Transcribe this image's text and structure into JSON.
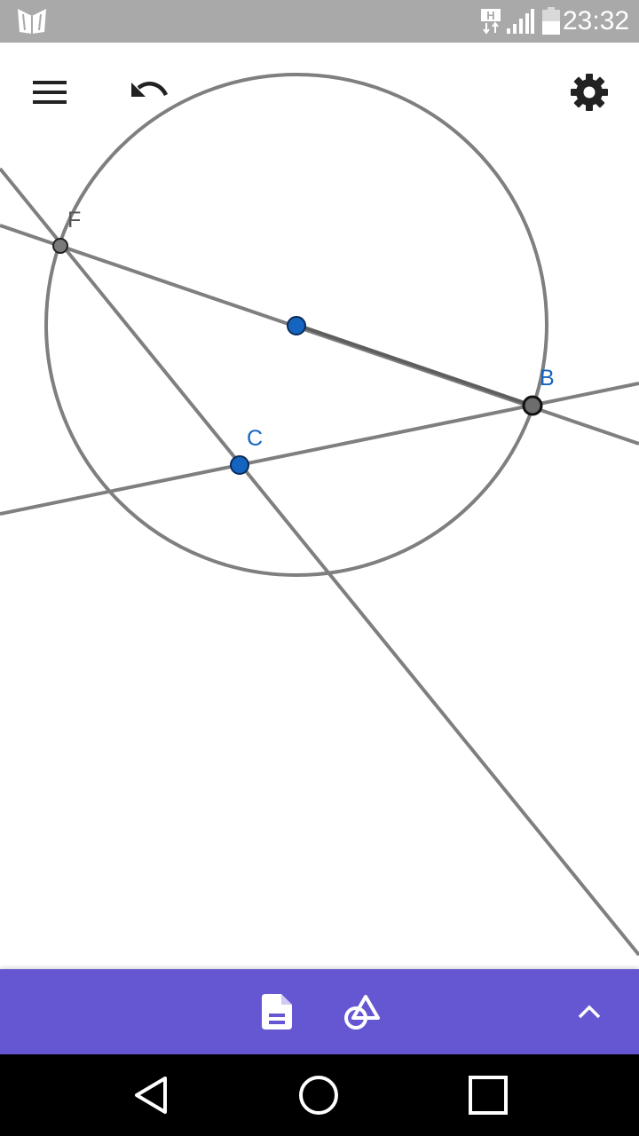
{
  "status_bar": {
    "time": "23:32",
    "network_label": "H"
  },
  "toolbar": {
    "menu_icon": "hamburger-menu-icon",
    "undo_icon": "undo-icon",
    "settings_icon": "gear-icon"
  },
  "graphics": {
    "points": [
      {
        "name": "F",
        "label": "F",
        "color": "#555555"
      },
      {
        "name": "B",
        "label": "B",
        "color": "#1565c0"
      },
      {
        "name": "C",
        "label": "C",
        "color": "#1565c0"
      },
      {
        "name": "center",
        "label": "",
        "color": "#1565c0"
      }
    ],
    "object_color": "#7f7f7f",
    "free_point_color": "#1565c0"
  },
  "bottom_bar": {
    "background": "#6557d2",
    "algebra_icon": "document-icon",
    "tools_icon": "shapes-tool-icon",
    "expand_icon": "chevron-up-icon"
  },
  "nav_bar": {
    "back_icon": "back-triangle-icon",
    "home_icon": "home-circle-icon",
    "recents_icon": "recents-square-icon"
  }
}
